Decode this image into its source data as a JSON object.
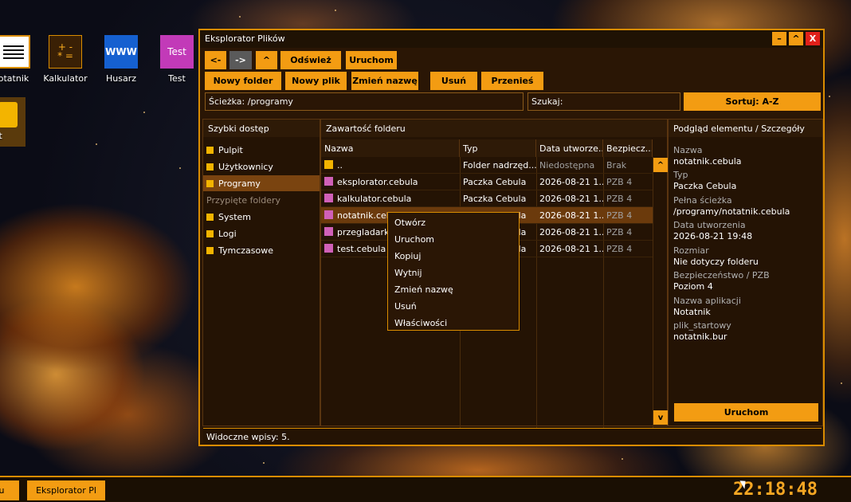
{
  "desktop": {
    "icons": [
      {
        "label": "otatnik",
        "icon": "notepad-icon"
      },
      {
        "label": "Kalkulator",
        "icon": "calculator-icon",
        "glyph": "+ -\n* ="
      },
      {
        "label": "Husarz",
        "icon": "browser-icon",
        "glyph": "WWW"
      },
      {
        "label": "Test",
        "icon": "test-icon",
        "glyph": "Test"
      },
      {
        "label": "est",
        "icon": "folder-icon"
      }
    ]
  },
  "window": {
    "title": "Eksplorator Plików",
    "controls": {
      "minimize": "–",
      "maximize": "^",
      "close": "X"
    },
    "toolbar": {
      "back": "<-",
      "forward": "->",
      "up": "^",
      "refresh": "Odśwież",
      "run": "Uruchom",
      "new_folder": "Nowy folder",
      "new_file": "Nowy plik",
      "rename": "Zmień nazwę",
      "delete": "Usuń",
      "move": "Przenieś"
    },
    "path_field": "Ścieżka: /programy",
    "search_field": "Szukaj:",
    "sort_button": "Sortuj: A-Z",
    "quick_access": {
      "title": "Szybki dostęp",
      "items": [
        "Pulpit",
        "Użytkownicy",
        "Programy"
      ],
      "pinned_label": "Przypięte foldery",
      "pinned": [
        "System",
        "Logi",
        "Tymczasowe"
      ],
      "active": "Programy"
    },
    "content": {
      "title": "Zawartość folderu",
      "columns": [
        "Nazwa",
        "Typ",
        "Data utworze...",
        "Bezpiecz..."
      ],
      "rows": [
        {
          "name": "..",
          "type": "Folder nadrzęd...",
          "date": "Niedostępna",
          "sec": "Brak",
          "folder": true
        },
        {
          "name": "eksplorator.cebula",
          "type": "Paczka Cebula",
          "date": "2026-08-21 1...",
          "sec": "PZB 4"
        },
        {
          "name": "kalkulator.cebula",
          "type": "Paczka Cebula",
          "date": "2026-08-21 1...",
          "sec": "PZB 4"
        },
        {
          "name": "notatnik.cebula",
          "type": "Paczka Cebula",
          "date": "2026-08-21 1...",
          "sec": "PZB 4",
          "selected": true
        },
        {
          "name": "przegladarka.cebula",
          "type": "Paczka Cebula",
          "date": "2026-08-21 1...",
          "sec": "PZB 4"
        },
        {
          "name": "test.cebula",
          "type": "Paczka Cebula",
          "date": "2026-08-21 1...",
          "sec": "PZB 4"
        }
      ],
      "scroll_up": "^",
      "scroll_down": "v"
    },
    "details": {
      "title": "Podgląd elementu / Szczegóły",
      "fields": [
        {
          "label": "Nazwa",
          "value": "notatnik.cebula"
        },
        {
          "label": "Typ",
          "value": "Paczka Cebula"
        },
        {
          "label": "Pełna ścieżka",
          "value": "/programy/notatnik.cebula"
        },
        {
          "label": "Data utworzenia",
          "value": "2026-08-21 19:48"
        },
        {
          "label": "Rozmiar",
          "value": "Nie dotyczy folderu"
        },
        {
          "label": "Bezpieczeństwo / PZB",
          "value": "Poziom 4"
        },
        {
          "label": "Nazwa aplikacji",
          "value": "Notatnik"
        },
        {
          "label": "plik_startowy",
          "value": "notatnik.bur"
        }
      ],
      "run_button": "Uruchom"
    },
    "context_menu": [
      "Otwórz",
      "Uruchom",
      "Kopiuj",
      "Wytnij",
      "Zmień nazwę",
      "Usuń",
      "Właściwości"
    ],
    "status": "Widoczne wpisy: 5."
  },
  "taskbar": {
    "start_label": "u",
    "task_label": "Eksplorator Pl",
    "clock": "22:18:48"
  },
  "colors": {
    "accent": "#f39c12",
    "panel": "#241304",
    "border": "#d98c00"
  }
}
